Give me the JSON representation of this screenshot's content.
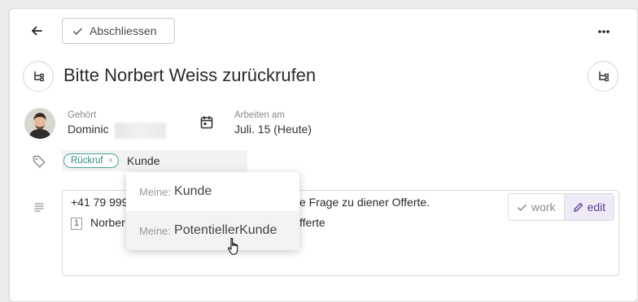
{
  "toolbar": {
    "finish_label": "Abschliessen",
    "back_icon": "arrow-left-icon",
    "more_label": "..."
  },
  "task": {
    "title": "Bitte Norbert Weiss zurückrufen"
  },
  "owner": {
    "label": "Gehört",
    "name": "Dominic"
  },
  "schedule": {
    "label": "Arbeiten am",
    "value": "Juli. 15 (Heute)"
  },
  "tags": {
    "chips": [
      "Rückruf"
    ],
    "input_value": "Kunde"
  },
  "dropdown": {
    "items": [
      {
        "prefix": "Meine:",
        "value": "Kunde"
      },
      {
        "prefix": "Meine:",
        "value": "PotentiellerKunde"
      }
    ]
  },
  "description": {
    "line1_left": "+41 79 999",
    "line1_right": "e Frage zu diener Offerte.",
    "line2_num": "1",
    "line2_left": "Norber",
    "line2_right": "fferte"
  },
  "editor_actions": {
    "work_label": "work",
    "edit_label": "edit"
  },
  "colors": {
    "tag_accent": "#4aa396",
    "edit_accent": "#5b3f92"
  }
}
